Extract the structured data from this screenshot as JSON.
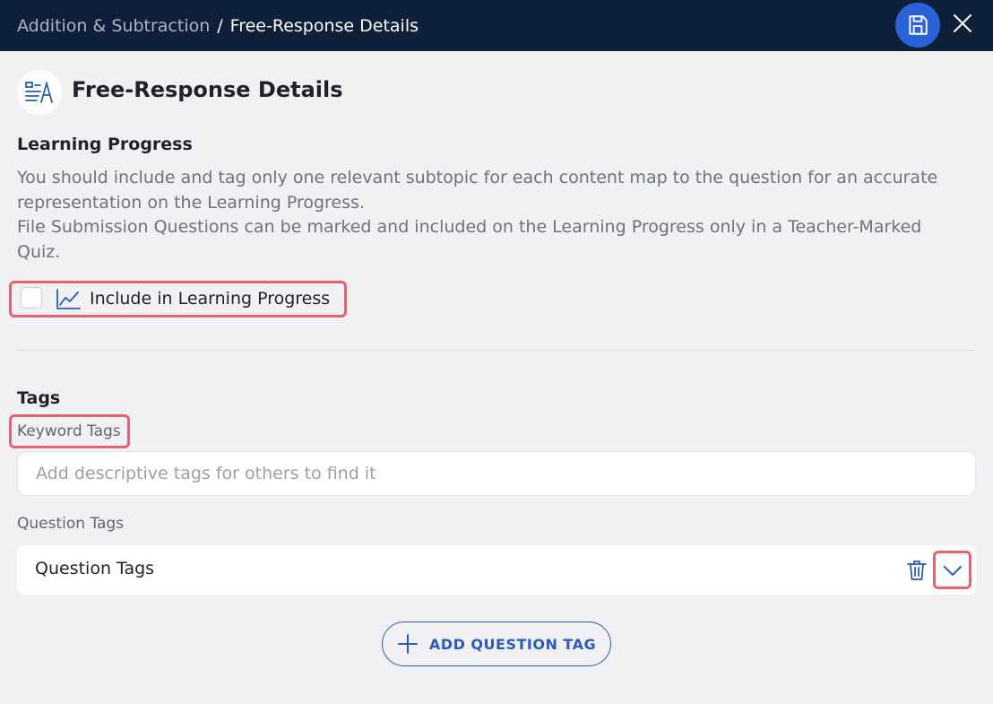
{
  "breadcrumb": {
    "parent": "Addition & Subtraction",
    "separator": "/",
    "current": "Free-Response Details"
  },
  "toolbar": {
    "save_icon": "floppy-disk-icon",
    "close_icon": "close-icon"
  },
  "header": {
    "icon": "free-response-icon",
    "title": "Free-Response Details"
  },
  "learning_progress": {
    "title": "Learning Progress",
    "info_line_1": "You should include and tag only one relevant subtopic for each content map to the question for an accurate representation on the Learning Progress.",
    "info_line_2": "File Submission Questions can be marked and included on the Learning Progress only in a Teacher-Marked Quiz.",
    "checkbox_label": "Include in Learning Progress",
    "checkbox_checked": false,
    "checkbox_icon": "line-chart-icon"
  },
  "tags": {
    "title": "Tags",
    "keyword_label": "Keyword Tags",
    "keyword_placeholder": "Add descriptive tags for others to find it",
    "keyword_value": "",
    "question_tags_label": "Question Tags",
    "question_tags_value": "Question Tags",
    "delete_icon": "trash-icon",
    "expand_icon": "chevron-down-icon",
    "add_button_label": "ADD QUESTION TAG",
    "add_button_icon": "plus-icon"
  },
  "colors": {
    "topbar": "#0e1f3a",
    "accent": "#2a63d9",
    "highlight": "#e06571",
    "background": "#f1f1f4"
  }
}
